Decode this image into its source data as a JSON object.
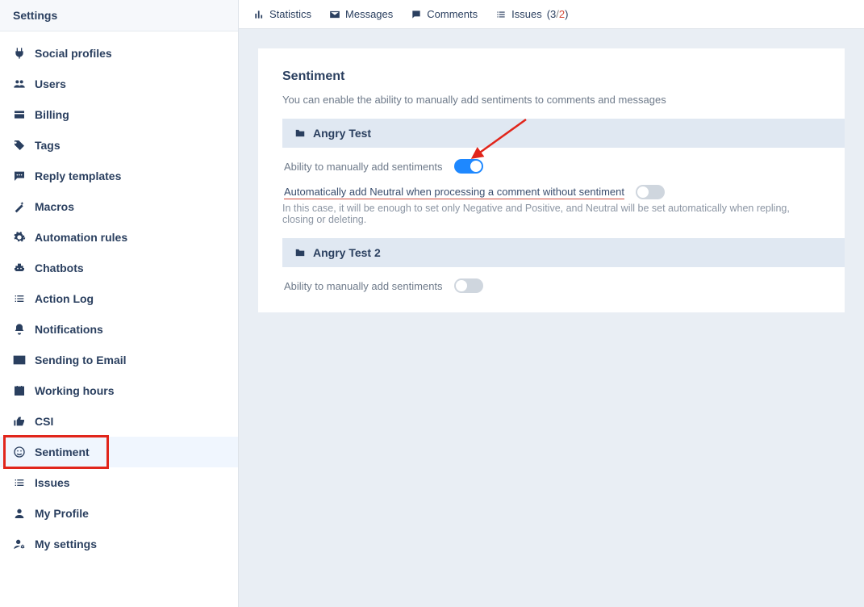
{
  "sidebar": {
    "title": "Settings",
    "items": [
      {
        "icon": "plug",
        "label": "Social profiles"
      },
      {
        "icon": "users",
        "label": "Users"
      },
      {
        "icon": "card",
        "label": "Billing"
      },
      {
        "icon": "tags",
        "label": "Tags"
      },
      {
        "icon": "chat",
        "label": "Reply templates"
      },
      {
        "icon": "wand",
        "label": "Macros"
      },
      {
        "icon": "cogs",
        "label": "Automation rules"
      },
      {
        "icon": "robot",
        "label": "Chatbots"
      },
      {
        "icon": "list",
        "label": "Action Log"
      },
      {
        "icon": "bell",
        "label": "Notifications"
      },
      {
        "icon": "envelope",
        "label": "Sending to Email"
      },
      {
        "icon": "calendar",
        "label": "Working hours"
      },
      {
        "icon": "thumbs",
        "label": "CSI"
      },
      {
        "icon": "smile",
        "label": "Sentiment",
        "active": true,
        "highlight": true
      },
      {
        "icon": "list",
        "label": "Issues"
      },
      {
        "icon": "user",
        "label": "My Profile"
      },
      {
        "icon": "usercog",
        "label": "My settings"
      }
    ]
  },
  "topbar": {
    "statistics": "Statistics",
    "messages": "Messages",
    "comments": "Comments",
    "issues_label": "Issues",
    "issues_count_a": "3",
    "issues_count_b": "2"
  },
  "content": {
    "title": "Sentiment",
    "description": "You can enable the ability to manually add sentiments to comments and messages",
    "sections": [
      {
        "header": "Angry Test",
        "rows": [
          {
            "label": "Ability to manually add sentiments",
            "toggle": true,
            "arrow": true
          },
          {
            "label": "Automatically add Neutral when processing a comment without sentiment",
            "toggle": false,
            "underlined": true,
            "hint": "In this case, it will be enough to set only Negative and Positive, and Neutral will be set automatically when repling, closing or deleting."
          }
        ]
      },
      {
        "header": "Angry Test 2",
        "rows": [
          {
            "label": "Ability to manually add sentiments",
            "toggle": false
          }
        ]
      }
    ]
  }
}
